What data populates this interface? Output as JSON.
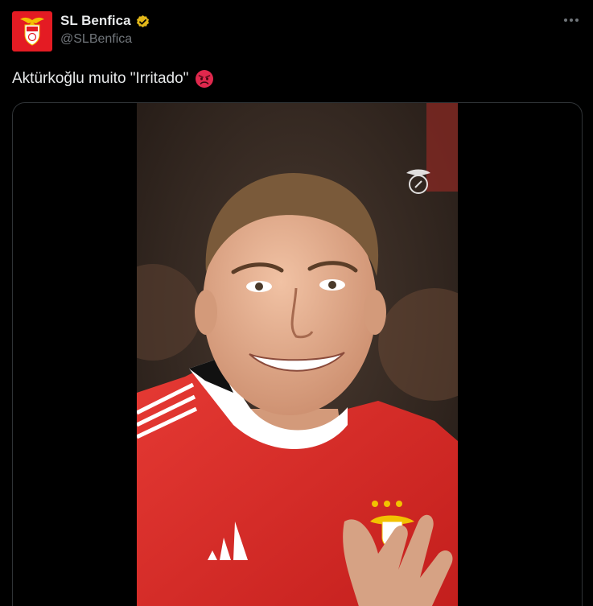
{
  "post": {
    "author": {
      "display_name": "SL Benfica",
      "handle": "@SLBenfica",
      "verified_badge": "gold-verified-icon",
      "avatar": "benfica-crest-logo"
    },
    "text": "Aktürkoğlu muito \"Irritado\"",
    "emoji": "angry-face-emoji",
    "more_icon": "more-options-icon",
    "media": {
      "type": "video",
      "description_icon": "benfica-watermark-icon"
    }
  },
  "colors": {
    "background": "#000000",
    "text_primary": "#e7e9ea",
    "text_secondary": "#71767b",
    "brand_red": "#e41b23",
    "verified_gold": "#e2b719",
    "border": "#2f3336"
  }
}
